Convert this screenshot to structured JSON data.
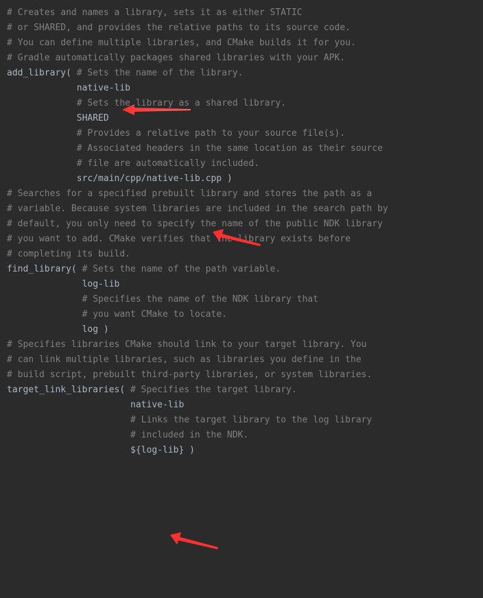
{
  "lines": {
    "l1": "# Creates and names a library, sets it as either STATIC",
    "l2": "# or SHARED, and provides the relative paths to its source code.",
    "l3": "# You can define multiple libraries, and CMake builds it for you.",
    "l4": "# Gradle automatically packages shared libraries with your APK.",
    "l5": "",
    "l6a": "add_library",
    "l6b": "( ",
    "l6c": "# Sets the name of the library.",
    "l7": "             native-lib",
    "l8": "",
    "l9": "             # Sets the library as a shared library.",
    "l10": "             SHARED",
    "l11": "",
    "l12": "             # Provides a relative path to your source file(s).",
    "l13": "             # Associated headers in the same location as their source",
    "l14": "             # file are automatically included.",
    "l15a": "             src/main/cpp/native-lib.cpp ",
    "l15b": ")",
    "l16": "",
    "l17": "# Searches for a specified prebuilt library and stores the path as a",
    "l18": "# variable. Because system libraries are included in the search path by",
    "l19": "# default, you only need to specify the name of the public NDK library",
    "l20": "# you want to add. CMake verifies that the library exists before",
    "l21": "# completing its build.",
    "l22": "",
    "l23a": "find_library",
    "l23b": "( ",
    "l23c": "# Sets the name of the path variable.",
    "l24": "              log-lib",
    "l25": "",
    "l26": "              # Specifies the name of the NDK library that",
    "l27": "              # you want CMake to locate.",
    "l28a": "              log ",
    "l28b": ")",
    "l29": "",
    "l30": "# Specifies libraries CMake should link to your target library. You",
    "l31": "# can link multiple libraries, such as libraries you define in the",
    "l32": "# build script, prebuilt third-party libraries, or system libraries.",
    "l33": "",
    "l34a": "target_link_libraries",
    "l34b": "( ",
    "l34c": "# Specifies the target library.",
    "l35": "                       native-lib",
    "l36": "",
    "l37": "                       # Links the target library to the log library",
    "l38": "                       # included in the NDK.",
    "l39a": "                       ${log-lib} ",
    "l39b": ")"
  }
}
